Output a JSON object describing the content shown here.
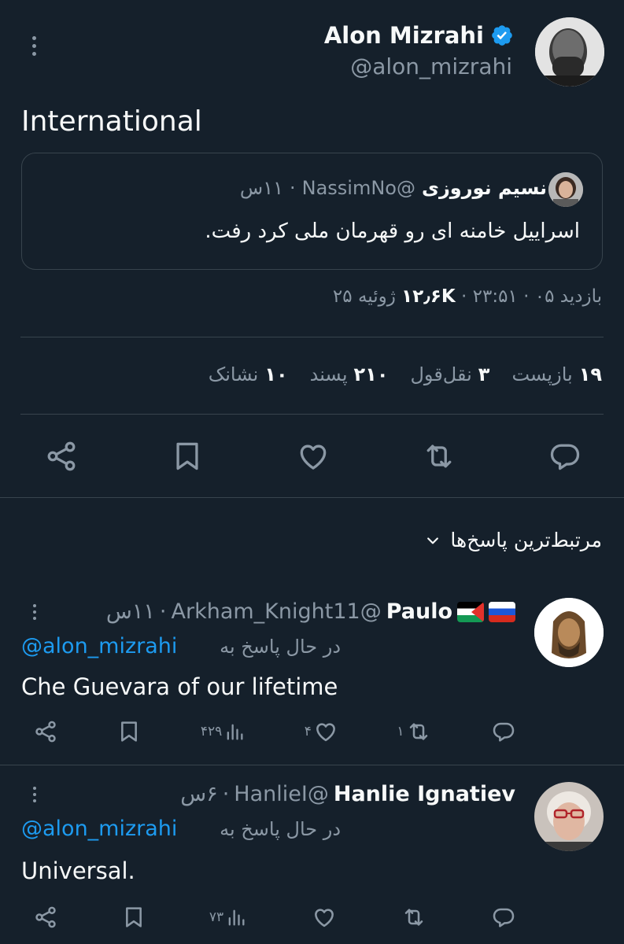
{
  "post": {
    "author_name": "Alon Mizrahi",
    "author_handle": "@alon_mizrahi",
    "text": "International",
    "quoted": {
      "name": "نسیم نوروزی",
      "handle": "@NassimNo",
      "time": "۱۱س",
      "text": "اسراییل خامنه ای رو قهرمان ملی کرد رفت."
    },
    "views_label": "بازدید",
    "views_value": "۱۲٫۶K",
    "time": "۲۳:۵۱",
    "date": "۰۵ ژوئیه ۲۵",
    "separator": "·",
    "stats": [
      {
        "value": "۱۹",
        "label": "بازپست"
      },
      {
        "value": "۳",
        "label": "نقل‌قول"
      },
      {
        "value": "۲۱۰",
        "label": "پسند"
      },
      {
        "value": "۱۰",
        "label": "نشانک"
      }
    ]
  },
  "sort_label": "مرتبط‌ترین پاسخ‌ها",
  "replies": [
    {
      "name": "Paulo",
      "handle": "@Arkham_Knight11",
      "time": "۱۱س",
      "replying_label": "در حال پاسخ به",
      "replying_to": "@alon_mizrahi",
      "text": "Che Guevara of our lifetime",
      "reply_count": "",
      "retweet_count": "۱",
      "like_count": "۴",
      "view_count": "۴۲۹"
    },
    {
      "name": "Hanlie Ignatiev",
      "handle": "@HanlieI",
      "time": "۶س",
      "replying_label": "در حال پاسخ به",
      "replying_to": "@alon_mizrahi",
      "text": "Universal.",
      "reply_count": "",
      "retweet_count": "",
      "like_count": "",
      "view_count": "۷۳"
    }
  ],
  "colors": {
    "background": "#15202b",
    "text": "#f7f9f9",
    "muted": "#8b98a5",
    "accent": "#1d9bf0",
    "border": "#38444d"
  },
  "icons": [
    "more-icon",
    "verified-badge-icon",
    "share-icon",
    "bookmark-icon",
    "like-icon",
    "retweet-icon",
    "reply-icon",
    "chevron-down-icon",
    "views-icon"
  ]
}
